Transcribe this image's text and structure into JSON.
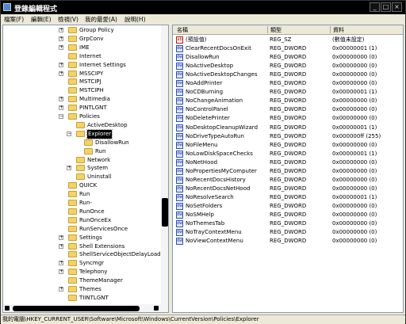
{
  "window": {
    "title": "登錄編輯程式"
  },
  "menu": [
    "檔案(F)",
    "編輯(E)",
    "檢視(V)",
    "我的最愛(A)",
    "說明(H)"
  ],
  "tree": [
    {
      "label": "Group Policy",
      "toggle": "+"
    },
    {
      "label": "GrpConv",
      "toggle": "+"
    },
    {
      "label": "IME",
      "toggle": "+"
    },
    {
      "label": "Internet",
      "toggle": ""
    },
    {
      "label": "Internet Settings",
      "toggle": "+"
    },
    {
      "label": "MSSCIPY",
      "toggle": "+"
    },
    {
      "label": "MSTCIPJ",
      "toggle": ""
    },
    {
      "label": "MSTCIPH",
      "toggle": ""
    },
    {
      "label": "Multimedia",
      "toggle": "+"
    },
    {
      "label": "PINTLGNT",
      "toggle": "+"
    },
    {
      "label": "Policies",
      "toggle": "−"
    },
    {
      "label": "ActiveDesktop",
      "toggle": ""
    },
    {
      "label": "Explorer",
      "toggle": "−",
      "selected": true
    },
    {
      "label": "DisallowRun",
      "toggle": ""
    },
    {
      "label": "Run",
      "toggle": ""
    },
    {
      "label": "Network",
      "toggle": ""
    },
    {
      "label": "System",
      "toggle": "+"
    },
    {
      "label": "Uninstall",
      "toggle": ""
    },
    {
      "label": "QUICK",
      "toggle": ""
    },
    {
      "label": "Run",
      "toggle": ""
    },
    {
      "label": "Run-",
      "toggle": ""
    },
    {
      "label": "RunOnce",
      "toggle": ""
    },
    {
      "label": "RunOnceEx",
      "toggle": ""
    },
    {
      "label": "RunServicesOnce",
      "toggle": ""
    },
    {
      "label": "Settings",
      "toggle": "+"
    },
    {
      "label": "Shell Extensions",
      "toggle": "+"
    },
    {
      "label": "ShellServiceObjectDelayLoad",
      "toggle": ""
    },
    {
      "label": "Syncmgr",
      "toggle": "+"
    },
    {
      "label": "Telephony",
      "toggle": "+"
    },
    {
      "label": "ThemeManager",
      "toggle": ""
    },
    {
      "label": "Themes",
      "toggle": "+"
    },
    {
      "label": "TIINTLGNT",
      "toggle": ""
    }
  ],
  "list": {
    "headers": {
      "name": "名稱",
      "type": "類型",
      "data": "資料"
    },
    "rows": [
      {
        "name": "(預設值)",
        "type": "REG_SZ",
        "data": "(數值未設定)",
        "icon": "ab"
      },
      {
        "name": "ClearRecentDocsOnExit",
        "type": "REG_DWORD",
        "data": "0x00000001 (1)",
        "icon": "dw"
      },
      {
        "name": "DisallowRun",
        "type": "REG_DWORD",
        "data": "0x00000000 (0)",
        "icon": "dw"
      },
      {
        "name": "NoActiveDesktop",
        "type": "REG_DWORD",
        "data": "0x00000000 (0)",
        "icon": "dw"
      },
      {
        "name": "NoActiveDesktopChanges",
        "type": "REG_DWORD",
        "data": "0x00000000 (0)",
        "icon": "dw"
      },
      {
        "name": "NoAddPrinter",
        "type": "REG_DWORD",
        "data": "0x00000000 (0)",
        "icon": "dw"
      },
      {
        "name": "NoCDBurning",
        "type": "REG_DWORD",
        "data": "0x00000001 (1)",
        "icon": "dw"
      },
      {
        "name": "NoChangeAnimation",
        "type": "REG_DWORD",
        "data": "0x00000000 (0)",
        "icon": "dw"
      },
      {
        "name": "NoControlPanel",
        "type": "REG_DWORD",
        "data": "0x00000000 (0)",
        "icon": "dw"
      },
      {
        "name": "NoDeletePrinter",
        "type": "REG_DWORD",
        "data": "0x00000000 (0)",
        "icon": "dw"
      },
      {
        "name": "NoDesktopCleanupWizard",
        "type": "REG_DWORD",
        "data": "0x00000001 (1)",
        "icon": "dw"
      },
      {
        "name": "NoDriveTypeAutoRun",
        "type": "REG_DWORD",
        "data": "0x000000ff (255)",
        "icon": "dw"
      },
      {
        "name": "NoFileMenu",
        "type": "REG_DWORD",
        "data": "0x00000000 (0)",
        "icon": "dw"
      },
      {
        "name": "NoLowDiskSpaceChecks",
        "type": "REG_DWORD",
        "data": "0x00000001 (1)",
        "icon": "dw"
      },
      {
        "name": "NoNetHood",
        "type": "REG_DWORD",
        "data": "0x00000000 (0)",
        "icon": "dw"
      },
      {
        "name": "NoPropertiesMyComputer",
        "type": "REG_DWORD",
        "data": "0x00000000 (0)",
        "icon": "dw"
      },
      {
        "name": "NoRecentDocsHistory",
        "type": "REG_DWORD",
        "data": "0x00000000 (0)",
        "icon": "dw"
      },
      {
        "name": "NoRecentDocsNetHood",
        "type": "REG_DWORD",
        "data": "0x00000000 (0)",
        "icon": "dw"
      },
      {
        "name": "NoResolveSearch",
        "type": "REG_DWORD",
        "data": "0x00000001 (1)",
        "icon": "dw"
      },
      {
        "name": "NoSetFolders",
        "type": "REG_DWORD",
        "data": "0x00000000 (0)",
        "icon": "dw"
      },
      {
        "name": "NoSMHelp",
        "type": "REG_DWORD",
        "data": "0x00000000 (0)",
        "icon": "dw"
      },
      {
        "name": "NoThemesTab",
        "type": "REG_DWORD",
        "data": "0x00000000 (0)",
        "icon": "dw"
      },
      {
        "name": "NoTrayContextMenu",
        "type": "REG_DWORD",
        "data": "0x00000000 (0)",
        "icon": "dw"
      },
      {
        "name": "NoViewContextMenu",
        "type": "REG_DWORD",
        "data": "0x00000000 (0)",
        "icon": "dw"
      }
    ]
  },
  "status": "我的電腦\\HKEY_CURRENT_USER\\Software\\Microsoft\\Windows\\CurrentVersion\\Policies\\Explorer"
}
